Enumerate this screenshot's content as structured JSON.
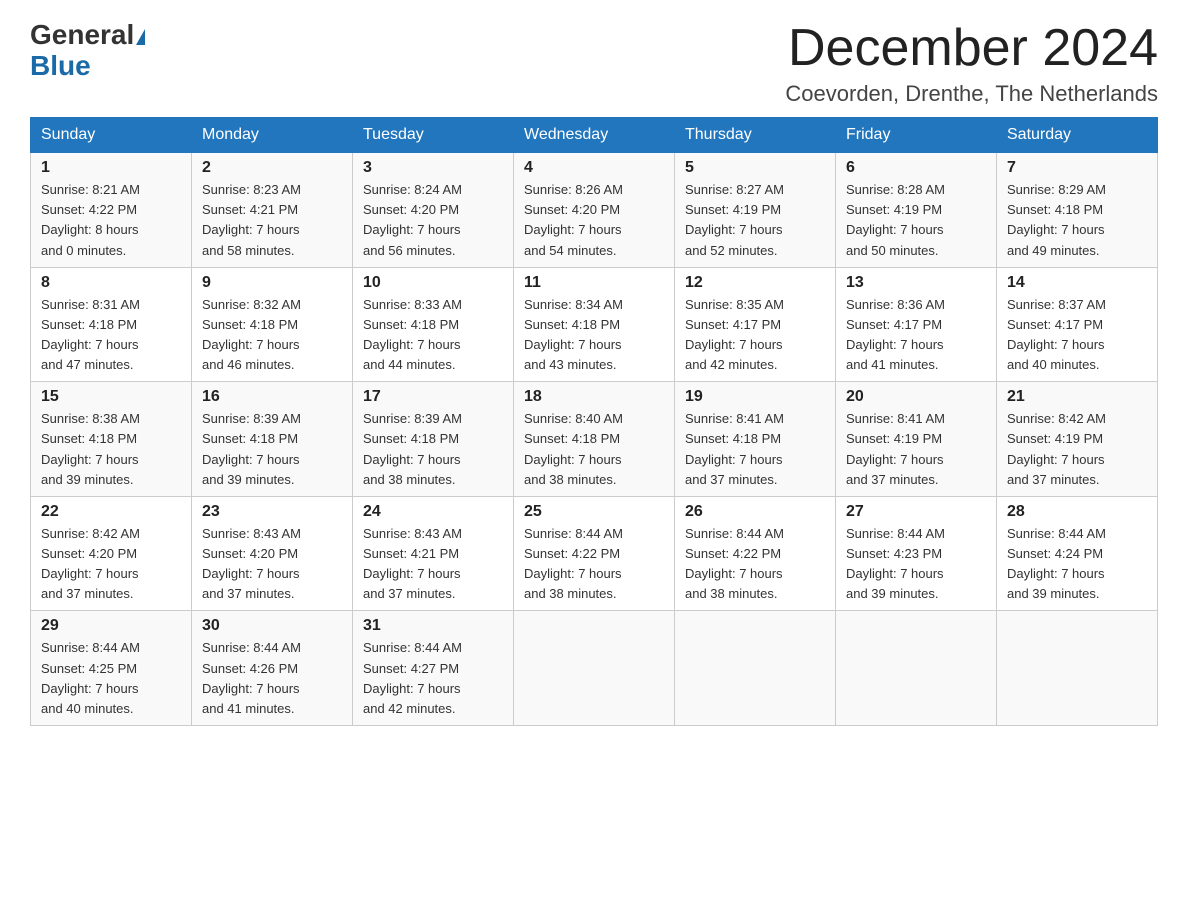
{
  "header": {
    "logo_general": "General",
    "logo_blue": "Blue",
    "month_title": "December 2024",
    "location": "Coevorden, Drenthe, The Netherlands"
  },
  "days_of_week": [
    "Sunday",
    "Monday",
    "Tuesday",
    "Wednesday",
    "Thursday",
    "Friday",
    "Saturday"
  ],
  "weeks": [
    [
      {
        "day": "1",
        "info": "Sunrise: 8:21 AM\nSunset: 4:22 PM\nDaylight: 8 hours\nand 0 minutes."
      },
      {
        "day": "2",
        "info": "Sunrise: 8:23 AM\nSunset: 4:21 PM\nDaylight: 7 hours\nand 58 minutes."
      },
      {
        "day": "3",
        "info": "Sunrise: 8:24 AM\nSunset: 4:20 PM\nDaylight: 7 hours\nand 56 minutes."
      },
      {
        "day": "4",
        "info": "Sunrise: 8:26 AM\nSunset: 4:20 PM\nDaylight: 7 hours\nand 54 minutes."
      },
      {
        "day": "5",
        "info": "Sunrise: 8:27 AM\nSunset: 4:19 PM\nDaylight: 7 hours\nand 52 minutes."
      },
      {
        "day": "6",
        "info": "Sunrise: 8:28 AM\nSunset: 4:19 PM\nDaylight: 7 hours\nand 50 minutes."
      },
      {
        "day": "7",
        "info": "Sunrise: 8:29 AM\nSunset: 4:18 PM\nDaylight: 7 hours\nand 49 minutes."
      }
    ],
    [
      {
        "day": "8",
        "info": "Sunrise: 8:31 AM\nSunset: 4:18 PM\nDaylight: 7 hours\nand 47 minutes."
      },
      {
        "day": "9",
        "info": "Sunrise: 8:32 AM\nSunset: 4:18 PM\nDaylight: 7 hours\nand 46 minutes."
      },
      {
        "day": "10",
        "info": "Sunrise: 8:33 AM\nSunset: 4:18 PM\nDaylight: 7 hours\nand 44 minutes."
      },
      {
        "day": "11",
        "info": "Sunrise: 8:34 AM\nSunset: 4:18 PM\nDaylight: 7 hours\nand 43 minutes."
      },
      {
        "day": "12",
        "info": "Sunrise: 8:35 AM\nSunset: 4:17 PM\nDaylight: 7 hours\nand 42 minutes."
      },
      {
        "day": "13",
        "info": "Sunrise: 8:36 AM\nSunset: 4:17 PM\nDaylight: 7 hours\nand 41 minutes."
      },
      {
        "day": "14",
        "info": "Sunrise: 8:37 AM\nSunset: 4:17 PM\nDaylight: 7 hours\nand 40 minutes."
      }
    ],
    [
      {
        "day": "15",
        "info": "Sunrise: 8:38 AM\nSunset: 4:18 PM\nDaylight: 7 hours\nand 39 minutes."
      },
      {
        "day": "16",
        "info": "Sunrise: 8:39 AM\nSunset: 4:18 PM\nDaylight: 7 hours\nand 39 minutes."
      },
      {
        "day": "17",
        "info": "Sunrise: 8:39 AM\nSunset: 4:18 PM\nDaylight: 7 hours\nand 38 minutes."
      },
      {
        "day": "18",
        "info": "Sunrise: 8:40 AM\nSunset: 4:18 PM\nDaylight: 7 hours\nand 38 minutes."
      },
      {
        "day": "19",
        "info": "Sunrise: 8:41 AM\nSunset: 4:18 PM\nDaylight: 7 hours\nand 37 minutes."
      },
      {
        "day": "20",
        "info": "Sunrise: 8:41 AM\nSunset: 4:19 PM\nDaylight: 7 hours\nand 37 minutes."
      },
      {
        "day": "21",
        "info": "Sunrise: 8:42 AM\nSunset: 4:19 PM\nDaylight: 7 hours\nand 37 minutes."
      }
    ],
    [
      {
        "day": "22",
        "info": "Sunrise: 8:42 AM\nSunset: 4:20 PM\nDaylight: 7 hours\nand 37 minutes."
      },
      {
        "day": "23",
        "info": "Sunrise: 8:43 AM\nSunset: 4:20 PM\nDaylight: 7 hours\nand 37 minutes."
      },
      {
        "day": "24",
        "info": "Sunrise: 8:43 AM\nSunset: 4:21 PM\nDaylight: 7 hours\nand 37 minutes."
      },
      {
        "day": "25",
        "info": "Sunrise: 8:44 AM\nSunset: 4:22 PM\nDaylight: 7 hours\nand 38 minutes."
      },
      {
        "day": "26",
        "info": "Sunrise: 8:44 AM\nSunset: 4:22 PM\nDaylight: 7 hours\nand 38 minutes."
      },
      {
        "day": "27",
        "info": "Sunrise: 8:44 AM\nSunset: 4:23 PM\nDaylight: 7 hours\nand 39 minutes."
      },
      {
        "day": "28",
        "info": "Sunrise: 8:44 AM\nSunset: 4:24 PM\nDaylight: 7 hours\nand 39 minutes."
      }
    ],
    [
      {
        "day": "29",
        "info": "Sunrise: 8:44 AM\nSunset: 4:25 PM\nDaylight: 7 hours\nand 40 minutes."
      },
      {
        "day": "30",
        "info": "Sunrise: 8:44 AM\nSunset: 4:26 PM\nDaylight: 7 hours\nand 41 minutes."
      },
      {
        "day": "31",
        "info": "Sunrise: 8:44 AM\nSunset: 4:27 PM\nDaylight: 7 hours\nand 42 minutes."
      },
      {
        "day": "",
        "info": ""
      },
      {
        "day": "",
        "info": ""
      },
      {
        "day": "",
        "info": ""
      },
      {
        "day": "",
        "info": ""
      }
    ]
  ]
}
